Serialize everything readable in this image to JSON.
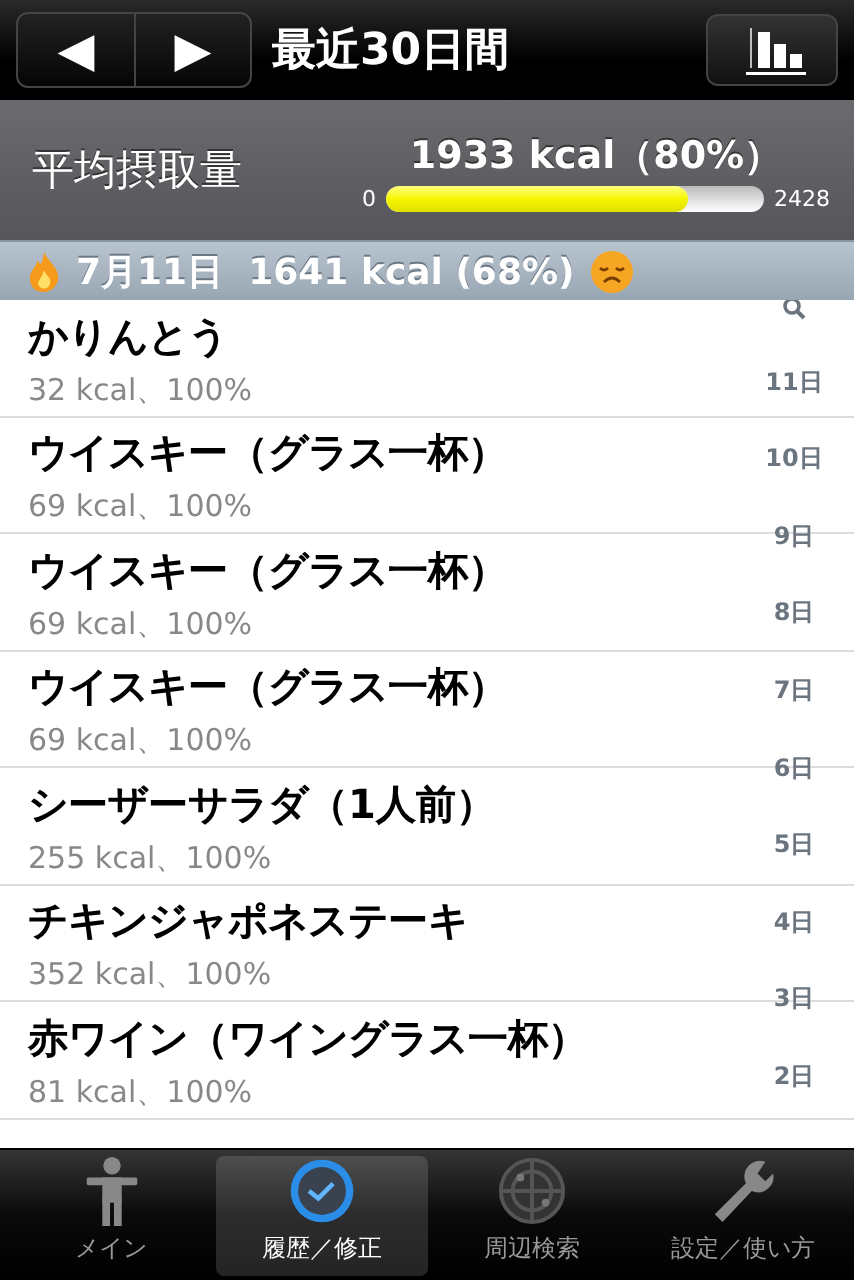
{
  "nav": {
    "prev": "◀",
    "next": "▶",
    "title": "最近30日間"
  },
  "summary": {
    "label": "平均摂取量",
    "value": "1933 kcal（80%）",
    "min": "0",
    "max": "2428",
    "level": 0.8
  },
  "section": {
    "text": "7月11日  1641 kcal (68%)"
  },
  "entries": [
    {
      "name": "かりんとう",
      "detail": "32 kcal、100%"
    },
    {
      "name": "ウイスキー（グラス一杯）",
      "detail": "69 kcal、100%"
    },
    {
      "name": "ウイスキー（グラス一杯）",
      "detail": "69 kcal、100%"
    },
    {
      "name": "ウイスキー（グラス一杯）",
      "detail": "69 kcal、100%"
    },
    {
      "name": "シーザーサラダ（1人前）",
      "detail": "255 kcal、100%"
    },
    {
      "name": "チキンジャポネステーキ",
      "detail": "352 kcal、100%"
    },
    {
      "name": "赤ワイン（ワイングラス一杯）",
      "detail": "81 kcal、100%"
    }
  ],
  "index": [
    "11日",
    "10日",
    "9日",
    "8日",
    "7日",
    "6日",
    "5日",
    "4日",
    "3日",
    "2日"
  ],
  "tabs": [
    {
      "label": "メイン",
      "selected": false
    },
    {
      "label": "履歴／修正",
      "selected": true
    },
    {
      "label": "周辺検索",
      "selected": false
    },
    {
      "label": "設定／使い方",
      "selected": false
    }
  ]
}
